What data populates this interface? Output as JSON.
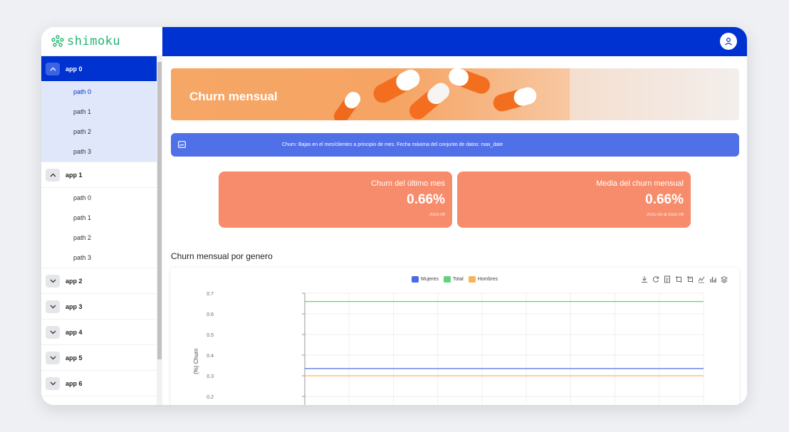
{
  "brand": {
    "name": "shimoku"
  },
  "sidebar": {
    "apps": [
      {
        "label": "app 0",
        "expanded": true,
        "paths": [
          "path 0",
          "path 1",
          "path 2",
          "path 3"
        ]
      },
      {
        "label": "app 1",
        "expanded": true,
        "paths": [
          "path 0",
          "path 1",
          "path 2",
          "path 3"
        ]
      },
      {
        "label": "app 2",
        "expanded": false
      },
      {
        "label": "app 3",
        "expanded": false
      },
      {
        "label": "app 4",
        "expanded": false
      },
      {
        "label": "app 5",
        "expanded": false
      },
      {
        "label": "app 6",
        "expanded": false
      }
    ]
  },
  "banner": {
    "title": "Churn mensual"
  },
  "info": {
    "text": "Churn: Bajas en el mes/clientes a principio de mes. Fecha máxima del conjunto de datos: max_date",
    "icon": "image-icon"
  },
  "kpis": [
    {
      "title": "Churn del último mes",
      "value": "0.66%",
      "footer": "2022-09"
    },
    {
      "title": "Media del churn mensual",
      "value": "0.66%",
      "footer": "2021-03 al 2022-09"
    }
  ],
  "section": {
    "title": "Churn mensual por genero"
  },
  "colors": {
    "primary": "#0032d2",
    "kpi": "#f78c6c",
    "info": "#5070e8",
    "mujeres": "#4a6be3",
    "total": "#5fd37e",
    "hombres": "#f5b55a"
  },
  "chart_data": {
    "type": "line",
    "ylabel": "(%) Churn",
    "yticks": [
      "0.7",
      "0.6",
      "0.5",
      "0.4",
      "0.3",
      "0.2"
    ],
    "ylim": [
      0.15,
      0.7
    ],
    "grid": true,
    "legend_position": "top-center",
    "series": [
      {
        "name": "Mujeres",
        "color": "#4a6be3",
        "values": [
          0.335,
          0.335
        ]
      },
      {
        "name": "Total",
        "color": "#5fd37e",
        "values": [
          0.66,
          0.66
        ]
      },
      {
        "name": "Hombres",
        "color": "#f5b55a",
        "values": [
          0.3,
          0.3
        ]
      }
    ]
  }
}
